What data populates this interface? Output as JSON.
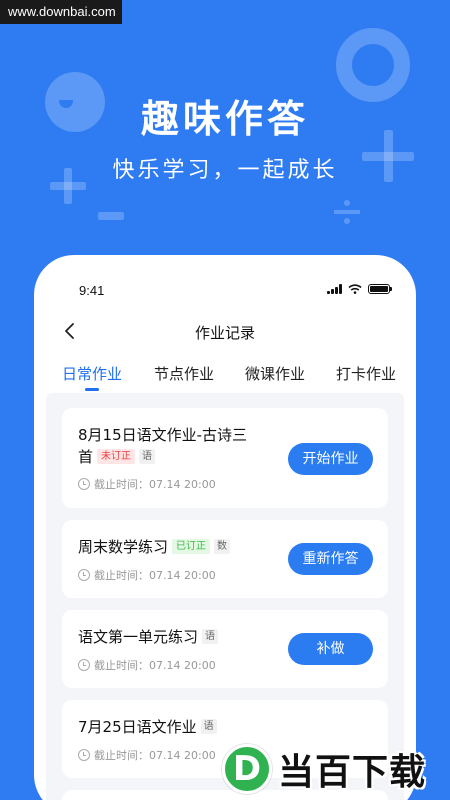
{
  "watermark": "www.downbai.com",
  "hero": {
    "title": "趣味作答",
    "subtitle": "快乐学习，一起成长"
  },
  "status": {
    "time": "9:41"
  },
  "nav": {
    "title": "作业记录"
  },
  "tabs": [
    {
      "label": "日常作业",
      "active": true
    },
    {
      "label": "节点作业",
      "active": false
    },
    {
      "label": "微课作业",
      "active": false
    },
    {
      "label": "打卡作业",
      "active": false
    }
  ],
  "cards": [
    {
      "title_line1": "8月15日语文作业-古诗三",
      "title_line2": "首",
      "badge": "未订正",
      "subject": "语",
      "deadline": "截止时间：07.14 20:00",
      "button": "开始作业"
    },
    {
      "title": "周末数学练习",
      "badge": "已订正",
      "subject": "数",
      "deadline": "截止时间：07.14 20:00",
      "button": "重新作答"
    },
    {
      "title": "语文第一单元练习",
      "subject": "语",
      "deadline": "截止时间：07.14 20:00",
      "button": "补做"
    },
    {
      "title": "7月25日语文作业",
      "subject": "语",
      "deadline": "截止时间：07.14 20:00"
    }
  ],
  "brand": {
    "letter": "D",
    "text": "当百下载"
  },
  "colors": {
    "background": "#2f7cf2",
    "accent": "#1f6ff0",
    "button": "#2a7cf0",
    "badge_red": "#ee4040",
    "badge_green": "#3cb84a",
    "brand_green": "#2fb24f"
  }
}
